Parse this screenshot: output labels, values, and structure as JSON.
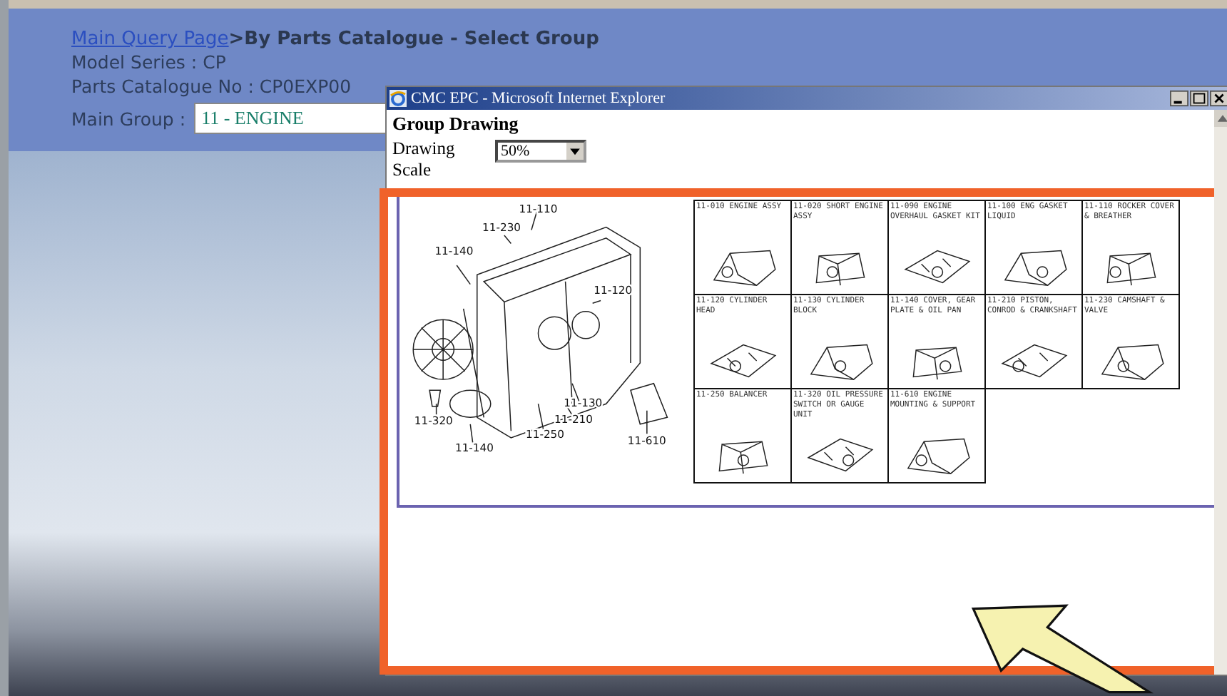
{
  "header": {
    "breadcrumb_link": "Main Query Page",
    "breadcrumb_current": ">By Parts Catalogue - Select Group",
    "model_series": "Model Series : CP",
    "catalogue_no": "Parts Catalogue No : CP0EXP00",
    "main_group_label": "Main Group :",
    "main_group_value": "11 - ENGINE"
  },
  "popup": {
    "title": "CMC EPC - Microsoft Internet Explorer",
    "heading": "Group Drawing",
    "scale_label": "Drawing Scale",
    "scale_value": "50%",
    "callouts": [
      "11-110",
      "11-230",
      "11-140",
      "11-120",
      "11-130",
      "11-210",
      "11-250",
      "11-320",
      "11-140",
      "11-610"
    ],
    "groups": [
      {
        "label": "11-010 ENGINE ASSY"
      },
      {
        "label": "11-020 SHORT ENGINE ASSY"
      },
      {
        "label": "11-090 ENGINE OVERHAUL GASKET KIT"
      },
      {
        "label": "11-100 ENG GASKET LIQUID"
      },
      {
        "label": "11-110 ROCKER COVER & BREATHER"
      },
      {
        "label": "11-120 CYLINDER HEAD"
      },
      {
        "label": "11-130 CYLINDER BLOCK"
      },
      {
        "label": "11-140 COVER, GEAR PLATE & OIL PAN"
      },
      {
        "label": "11-210 PISTON, CONROD & CRANKSHAFT"
      },
      {
        "label": "11-230 CAMSHAFT & VALVE"
      },
      {
        "label": "11-250 BALANCER"
      },
      {
        "label": "11-320 OIL PRESSURE SWITCH OR GAUGE UNIT"
      },
      {
        "label": "11-610 ENGINE MOUNTING & SUPPORT"
      }
    ]
  }
}
